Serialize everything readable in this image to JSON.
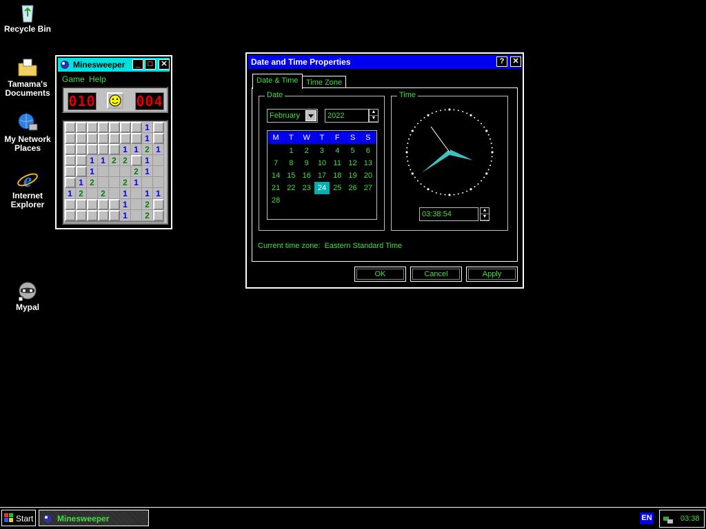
{
  "desktop": {
    "icons": [
      {
        "label": "Recycle Bin",
        "icon": "recycle-bin-icon"
      },
      {
        "label": "Tamama's Documents",
        "icon": "documents-folder-icon"
      },
      {
        "label": "My Network Places",
        "icon": "network-places-icon"
      },
      {
        "label": "Internet Explorer",
        "icon": "internet-explorer-icon"
      },
      {
        "label": "Mypal",
        "icon": "mypal-raccoon-icon"
      }
    ]
  },
  "minesweeper": {
    "title": "Minesweeper",
    "menu": [
      "Game",
      "Help"
    ],
    "mine_counter": "010",
    "timer": "004",
    "board": [
      [
        "#",
        "#",
        "#",
        "#",
        "#",
        "#",
        "#",
        "1",
        "#"
      ],
      [
        "#",
        "#",
        "#",
        "#",
        "#",
        "#",
        "#",
        "1",
        "#"
      ],
      [
        "#",
        "#",
        "#",
        "#",
        "#",
        "1",
        "1",
        "2",
        "1"
      ],
      [
        "#",
        "#",
        "1",
        "1",
        "2",
        "2",
        "#",
        "1",
        ""
      ],
      [
        "#",
        "#",
        "1",
        "",
        "",
        "",
        "2",
        "1",
        ""
      ],
      [
        "#",
        "1",
        "2",
        "",
        "",
        "2",
        "1",
        "",
        ""
      ],
      [
        "1",
        "2",
        "",
        "2",
        "",
        "1",
        "",
        "1",
        "1"
      ],
      [
        "#",
        "#",
        "#",
        "#",
        "#",
        "1",
        "",
        "2",
        "#"
      ],
      [
        "#",
        "#",
        "#",
        "#",
        "#",
        "1",
        "",
        "2",
        "#"
      ]
    ],
    "number_colors": {
      "1": "#0000ff",
      "2": "#008000"
    }
  },
  "datetime": {
    "title": "Date and Time Properties",
    "help_label": "?",
    "close_label": "✕",
    "tabs": [
      "Date & Time",
      "Time Zone"
    ],
    "date_group_label": "Date",
    "time_group_label": "Time",
    "month": "February",
    "year": "2022",
    "weekdays": [
      "M",
      "T",
      "W",
      "T",
      "F",
      "S",
      "S"
    ],
    "weeks": [
      [
        "",
        "1",
        "2",
        "3",
        "4",
        "5",
        "6"
      ],
      [
        "7",
        "8",
        "9",
        "10",
        "11",
        "12",
        "13"
      ],
      [
        "14",
        "15",
        "16",
        "17",
        "18",
        "19",
        "20"
      ],
      [
        "21",
        "22",
        "23",
        "24",
        "25",
        "26",
        "27"
      ],
      [
        "28",
        "",
        "",
        "",
        "",
        "",
        ""
      ]
    ],
    "selected_day": "24",
    "time_value": "03:38:54",
    "timezone_text": "Current time zone:  Eastern Standard Time",
    "ok_label": "OK",
    "cancel_label": "Cancel",
    "apply_label": "Apply",
    "clock": {
      "hours": 3,
      "minutes": 38,
      "seconds": 54
    }
  },
  "taskbar": {
    "start_label": "Start",
    "task_label": "Minesweeper",
    "language": "EN",
    "clock": "03:38"
  },
  "colors": {
    "accent_green": "#40e040",
    "title_blue": "#0000ee",
    "lcd_red": "#e00000",
    "hand_teal": "#40c0c0"
  }
}
